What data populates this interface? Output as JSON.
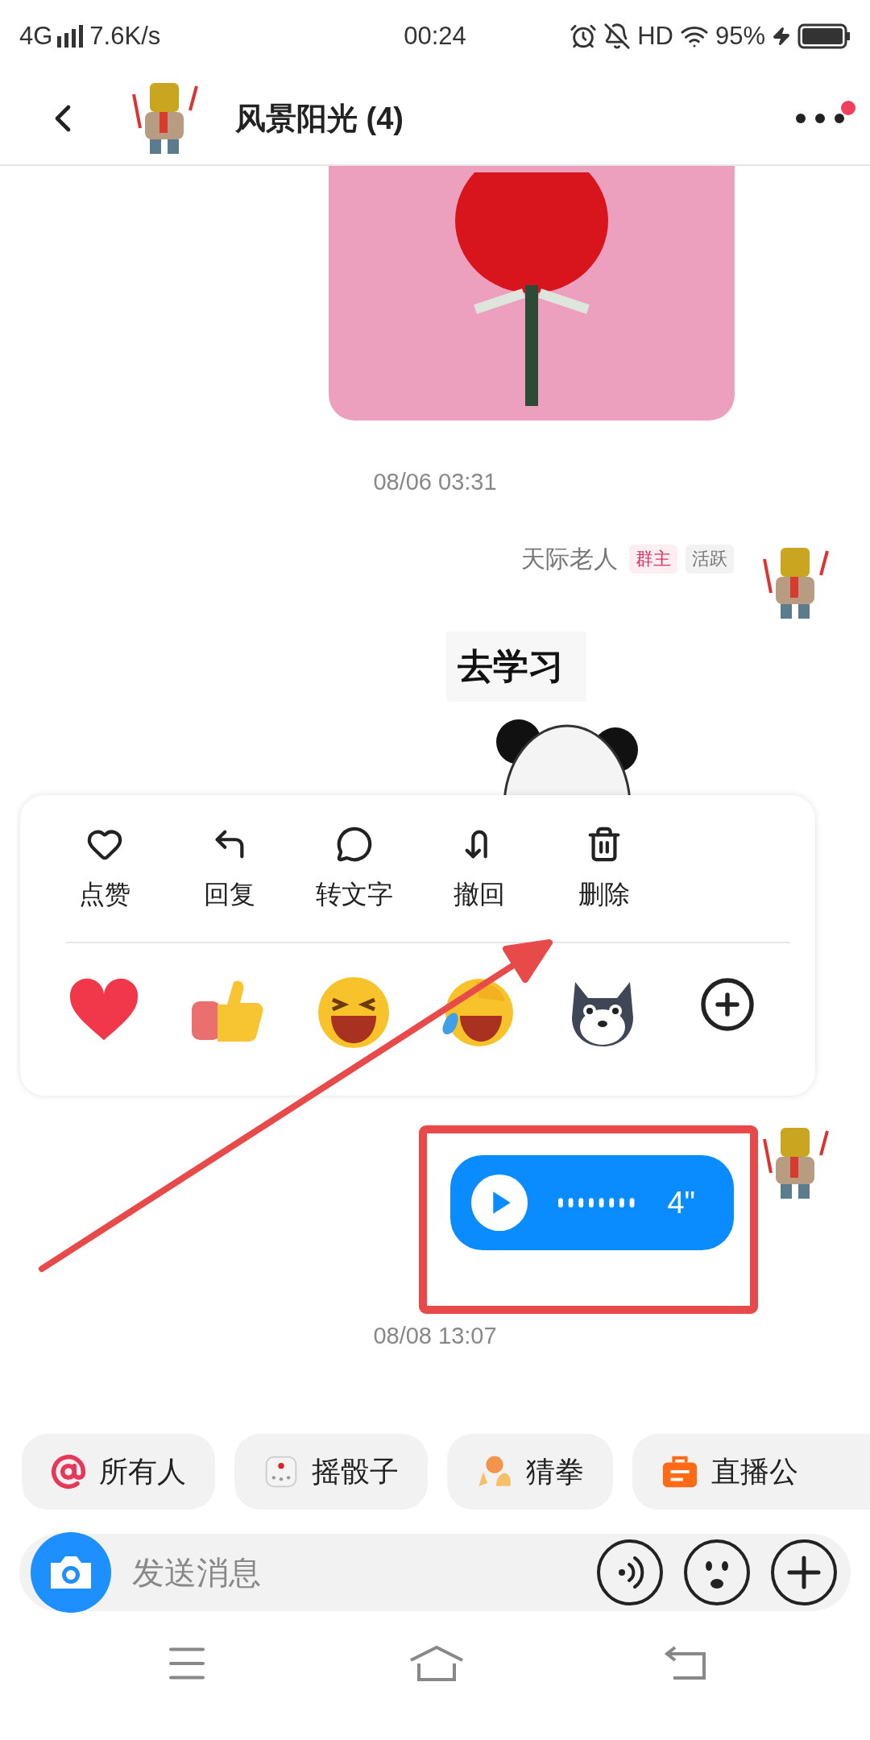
{
  "status_bar": {
    "network": "4G",
    "speed": "7.6K/s",
    "time": "00:24",
    "hd": "HD",
    "battery": "95%"
  },
  "header": {
    "title": "风景阳光 (4)",
    "more_dot": true
  },
  "chat": {
    "timestamp_1": "08/06 03:31",
    "sender": {
      "name": "天际老人",
      "tags": [
        {
          "label": "群主",
          "color": "#e0306a"
        },
        {
          "label": "活跃",
          "color": "#777777"
        }
      ]
    },
    "sticker_caption": "去学习",
    "voice": {
      "duration": "4\""
    },
    "timestamp_2": "08/08 13:07"
  },
  "context_menu": {
    "actions": [
      {
        "label": "点赞",
        "kind": "like"
      },
      {
        "label": "回复",
        "kind": "reply"
      },
      {
        "label": "转文字",
        "kind": "transcribe"
      },
      {
        "label": "撤回",
        "kind": "recall"
      },
      {
        "label": "删除",
        "kind": "delete"
      }
    ],
    "reactions": [
      {
        "kind": "heart"
      },
      {
        "kind": "thumbs"
      },
      {
        "kind": "laugh"
      },
      {
        "kind": "cry-laugh"
      },
      {
        "kind": "dog"
      },
      {
        "kind": "more"
      }
    ]
  },
  "quick_actions": [
    {
      "label": "所有人",
      "kind": "mention"
    },
    {
      "label": "摇骰子",
      "kind": "dice"
    },
    {
      "label": "猜拳",
      "kind": "rps"
    },
    {
      "label": "直播公",
      "kind": "live"
    }
  ],
  "input": {
    "placeholder": "发送消息"
  }
}
